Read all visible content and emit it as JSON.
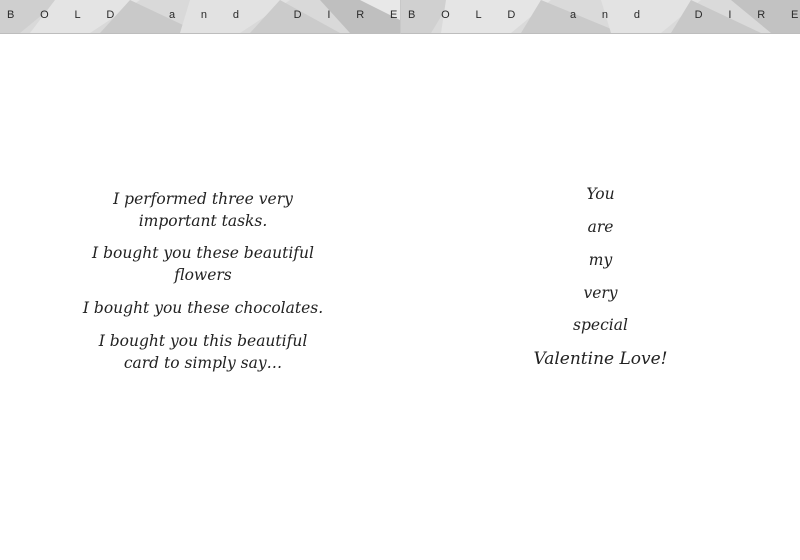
{
  "header": {
    "left_band": "BOLD and DIRECT",
    "right_band": "BOLD and DIRECT"
  },
  "left_page": {
    "stanzas": [
      {
        "line1": "I performed three very",
        "line2": "important tasks."
      },
      {
        "line1": "I bought you these beautiful",
        "line2": "flowers"
      },
      {
        "line1": "I bought you these chocolates."
      },
      {
        "line1": "I bought you this beautiful",
        "line2": "card to simply say…"
      }
    ]
  },
  "right_page": {
    "words": [
      "You",
      "are",
      "my",
      "very",
      "special",
      "Valentine Love!"
    ]
  },
  "colors": {
    "band": "#dcdcdc",
    "text": "#222222"
  }
}
